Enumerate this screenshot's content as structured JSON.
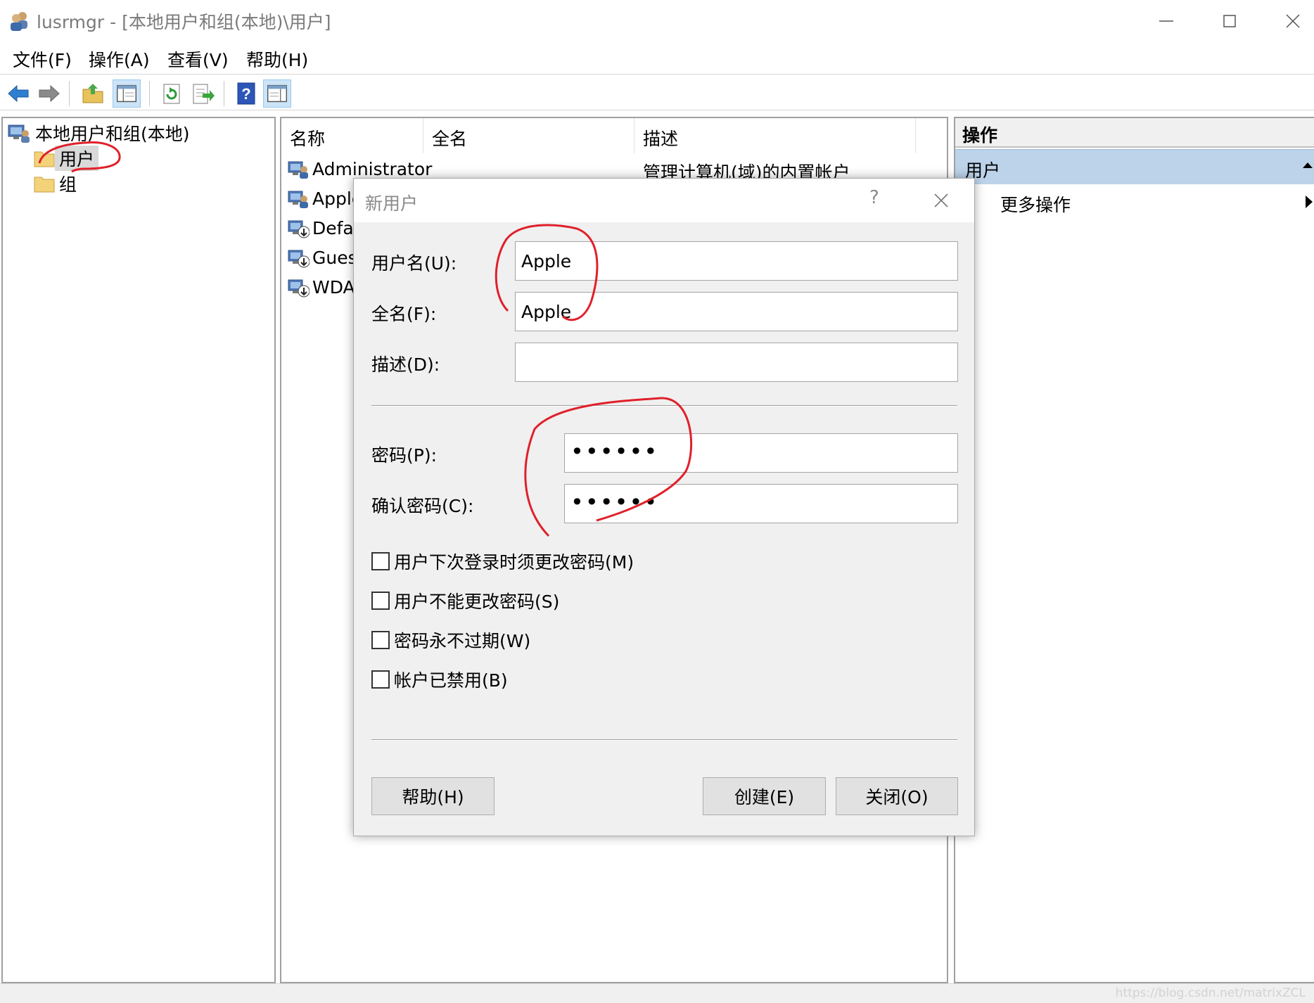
{
  "window": {
    "app_name": "lusrmgr",
    "title": "lusrmgr - [本地用户和组(本地)\\用户]"
  },
  "menu": [
    "文件(F)",
    "操作(A)",
    "查看(V)",
    "帮助(H)"
  ],
  "toolbar": {
    "buttons": [
      "back-icon",
      "forward-icon",
      "up-folder-icon",
      "show-hide-tree-icon",
      "refresh-icon",
      "export-list-icon",
      "help-icon",
      "show-hide-action-pane-icon"
    ]
  },
  "tree": {
    "root": "本地用户和组(本地)",
    "items": [
      {
        "label": "用户",
        "selected": true
      },
      {
        "label": "组",
        "selected": false
      }
    ]
  },
  "list": {
    "columns": [
      "名称",
      "全名",
      "描述"
    ],
    "rows": [
      {
        "name": "Administrator",
        "description": "管理计算机(域)的内置帐户"
      },
      {
        "name": "Apple",
        "description": ""
      },
      {
        "name": "Defau",
        "description": ""
      },
      {
        "name": "Gues",
        "description": ""
      },
      {
        "name": "WDA",
        "description": ""
      }
    ]
  },
  "actions": {
    "header": "操作",
    "section": "用户",
    "items": [
      "更多操作"
    ]
  },
  "dialog": {
    "title": "新用户",
    "help_glyph": "?",
    "fields": {
      "username": {
        "label": "用户名(U):",
        "value": "Apple"
      },
      "fullname": {
        "label": "全名(F):",
        "value": "Apple"
      },
      "description": {
        "label": "描述(D):",
        "value": ""
      },
      "password": {
        "label": "密码(P):",
        "value": "••••••"
      },
      "confirm": {
        "label": "确认密码(C):",
        "value": "••••••"
      }
    },
    "checkboxes": [
      {
        "label": "用户下次登录时须更改密码(M)",
        "checked": false
      },
      {
        "label": "用户不能更改密码(S)",
        "checked": false
      },
      {
        "label": "密码永不过期(W)",
        "checked": false
      },
      {
        "label": "帐户已禁用(B)",
        "checked": false
      }
    ],
    "buttons": {
      "help": "帮助(H)",
      "create": "创建(E)",
      "close": "关闭(O)"
    }
  },
  "statusbar": {
    "watermark": "https://blog.csdn.net/matrixZCL"
  },
  "colors": {
    "selection": "#cce4f7",
    "action_section": "#bcd3ea",
    "annotation_red": "#e0202a"
  }
}
